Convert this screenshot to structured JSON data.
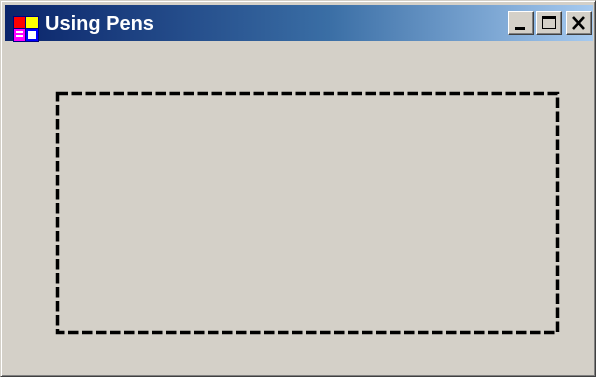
{
  "window": {
    "title": "Using Pens",
    "background": "#d4d0c8",
    "title_gradient": [
      "#0a246a",
      "#3a6ea5",
      "#a6caf0"
    ]
  },
  "title_buttons": [
    {
      "name": "minimize",
      "icon": "minimize-icon"
    },
    {
      "name": "maximize",
      "icon": "maximize-icon"
    },
    {
      "name": "close",
      "icon": "close-icon"
    }
  ],
  "drawing": {
    "shape": "rectangle",
    "pen_style": "dash",
    "pen_color": "#000000"
  }
}
